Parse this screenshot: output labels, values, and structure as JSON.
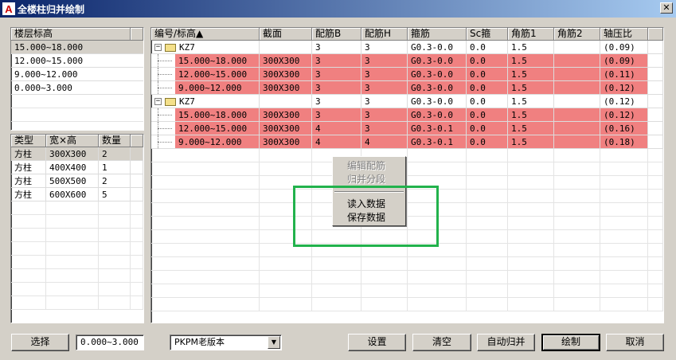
{
  "window": {
    "title": "全楼柱归并绘制",
    "close_symbol": "✕",
    "app_icon_letter": "A"
  },
  "floors": {
    "header": "楼层标高",
    "items": [
      "15.000~18.000",
      "12.000~15.000",
      "9.000~12.000",
      "0.000~3.000"
    ],
    "selected_index": 0
  },
  "types": {
    "headers": [
      "类型",
      "宽×高",
      "数量"
    ],
    "rows": [
      [
        "方柱",
        "300X300",
        "2"
      ],
      [
        "方柱",
        "400X400",
        "1"
      ],
      [
        "方柱",
        "500X500",
        "2"
      ],
      [
        "方柱",
        "600X600",
        "5"
      ]
    ],
    "selected_index": 0
  },
  "grid": {
    "headers": [
      "编号/标高▲",
      "截面",
      "配筋B",
      "配筋H",
      "箍筋",
      "Sc箍",
      "角筋1",
      "角筋2",
      "轴压比"
    ],
    "rows": [
      {
        "kind": "group",
        "cells": [
          "KZ7",
          "",
          "3",
          "3",
          "G0.3-0.0",
          "0.0",
          "1.5",
          "",
          "(0.09)"
        ]
      },
      {
        "kind": "child",
        "cells": [
          "15.000~18.000",
          "300X300",
          "3",
          "3",
          "G0.3-0.0",
          "0.0",
          "1.5",
          "",
          "(0.09)"
        ]
      },
      {
        "kind": "child",
        "cells": [
          "12.000~15.000",
          "300X300",
          "3",
          "3",
          "G0.3-0.0",
          "0.0",
          "1.5",
          "",
          "(0.11)"
        ]
      },
      {
        "kind": "child",
        "cells": [
          "9.000~12.000",
          "300X300",
          "3",
          "3",
          "G0.3-0.0",
          "0.0",
          "1.5",
          "",
          "(0.12)"
        ]
      },
      {
        "kind": "group",
        "cells": [
          "KZ7",
          "",
          "3",
          "3",
          "G0.3-0.0",
          "0.0",
          "1.5",
          "",
          "(0.12)"
        ]
      },
      {
        "kind": "child",
        "cells": [
          "15.000~18.000",
          "300X300",
          "3",
          "3",
          "G0.3-0.0",
          "0.0",
          "1.5",
          "",
          "(0.12)"
        ]
      },
      {
        "kind": "child",
        "cells": [
          "12.000~15.000",
          "300X300",
          "4",
          "3",
          "G0.3-0.1",
          "0.0",
          "1.5",
          "",
          "(0.16)"
        ]
      },
      {
        "kind": "child",
        "cells": [
          "9.000~12.000",
          "300X300",
          "4",
          "4",
          "G0.3-0.1",
          "0.0",
          "1.5",
          "",
          "(0.18)"
        ]
      }
    ],
    "highlight_color": "#f08080",
    "expander_symbol": "−"
  },
  "context_menu": {
    "items": [
      {
        "label": "编辑配筋",
        "enabled": false
      },
      {
        "label": "归并分段",
        "enabled": false
      },
      {
        "label": "读入数据",
        "enabled": true
      },
      {
        "label": "保存数据",
        "enabled": true
      }
    ]
  },
  "bottom": {
    "select_button": "选择",
    "floor_range_value": "0.000~3.000",
    "version_combo": "PKPM老版本",
    "combo_arrow": "▼",
    "settings_button": "设置",
    "clear_button": "清空",
    "auto_merge_button": "自动归并",
    "draw_button": "绘制",
    "cancel_button": "取消"
  },
  "annotation": {
    "color": "#22b24c"
  }
}
